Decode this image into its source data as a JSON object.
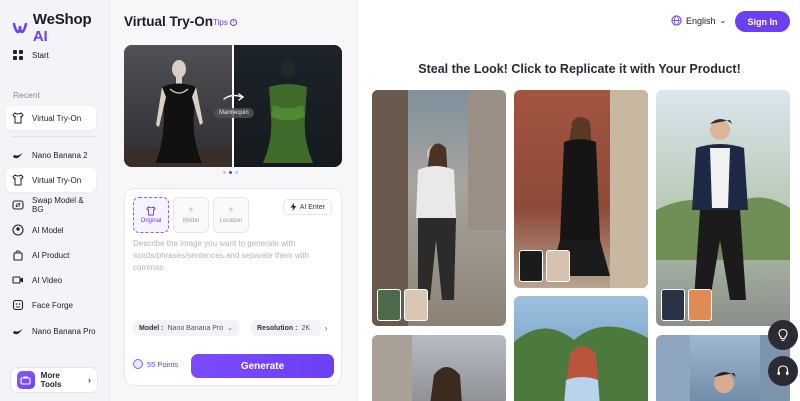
{
  "brand": {
    "name_prefix": "WeShop",
    "name_suffix": " AI",
    "accent": "#6c3ff5"
  },
  "sidebar": {
    "start_label": "Start",
    "recent_label": "Recent",
    "recent_items": [
      {
        "label": "Virtual Try-On",
        "icon": "tshirt-icon"
      }
    ],
    "items": [
      {
        "label": "Nano Banana 2",
        "icon": "banana-icon"
      },
      {
        "label": "Virtual Try-On",
        "icon": "tshirt-icon"
      },
      {
        "label": "Swap Model & BG",
        "icon": "swap-icon"
      },
      {
        "label": "AI Model",
        "icon": "model-icon"
      },
      {
        "label": "AI Product",
        "icon": "product-icon"
      },
      {
        "label": "AI Video",
        "icon": "video-icon"
      },
      {
        "label": "Face Forge",
        "icon": "face-icon"
      },
      {
        "label": "Nano Banana Pro",
        "icon": "banana-icon"
      }
    ],
    "more_tools_label": "More Tools"
  },
  "panel": {
    "title": "Virtual Try-On",
    "tips_label": "Tips",
    "preview_tag": "Mannequin",
    "carousel": {
      "count": 3,
      "active": 2
    },
    "slots": [
      {
        "label": "Original",
        "selected": true
      },
      {
        "label": "Model",
        "selected": false
      },
      {
        "label": "Location",
        "selected": false
      }
    ],
    "ai_enter_label": "AI Enter",
    "prompt_placeholder": "Describe the image you want to generate with words/phrases/sentences and separate them with commas",
    "model_chip": {
      "key": "Model :",
      "value": "Nano Banana Pro"
    },
    "resolution_chip": {
      "key": "Resolution :",
      "value": "2K"
    },
    "points_label": "55 Points",
    "generate_label": "Generate"
  },
  "header": {
    "language": "English",
    "signin_label": "Sign In"
  },
  "gallery": {
    "heading": "Steal the Look! Click to Replicate it with Your Product!"
  }
}
